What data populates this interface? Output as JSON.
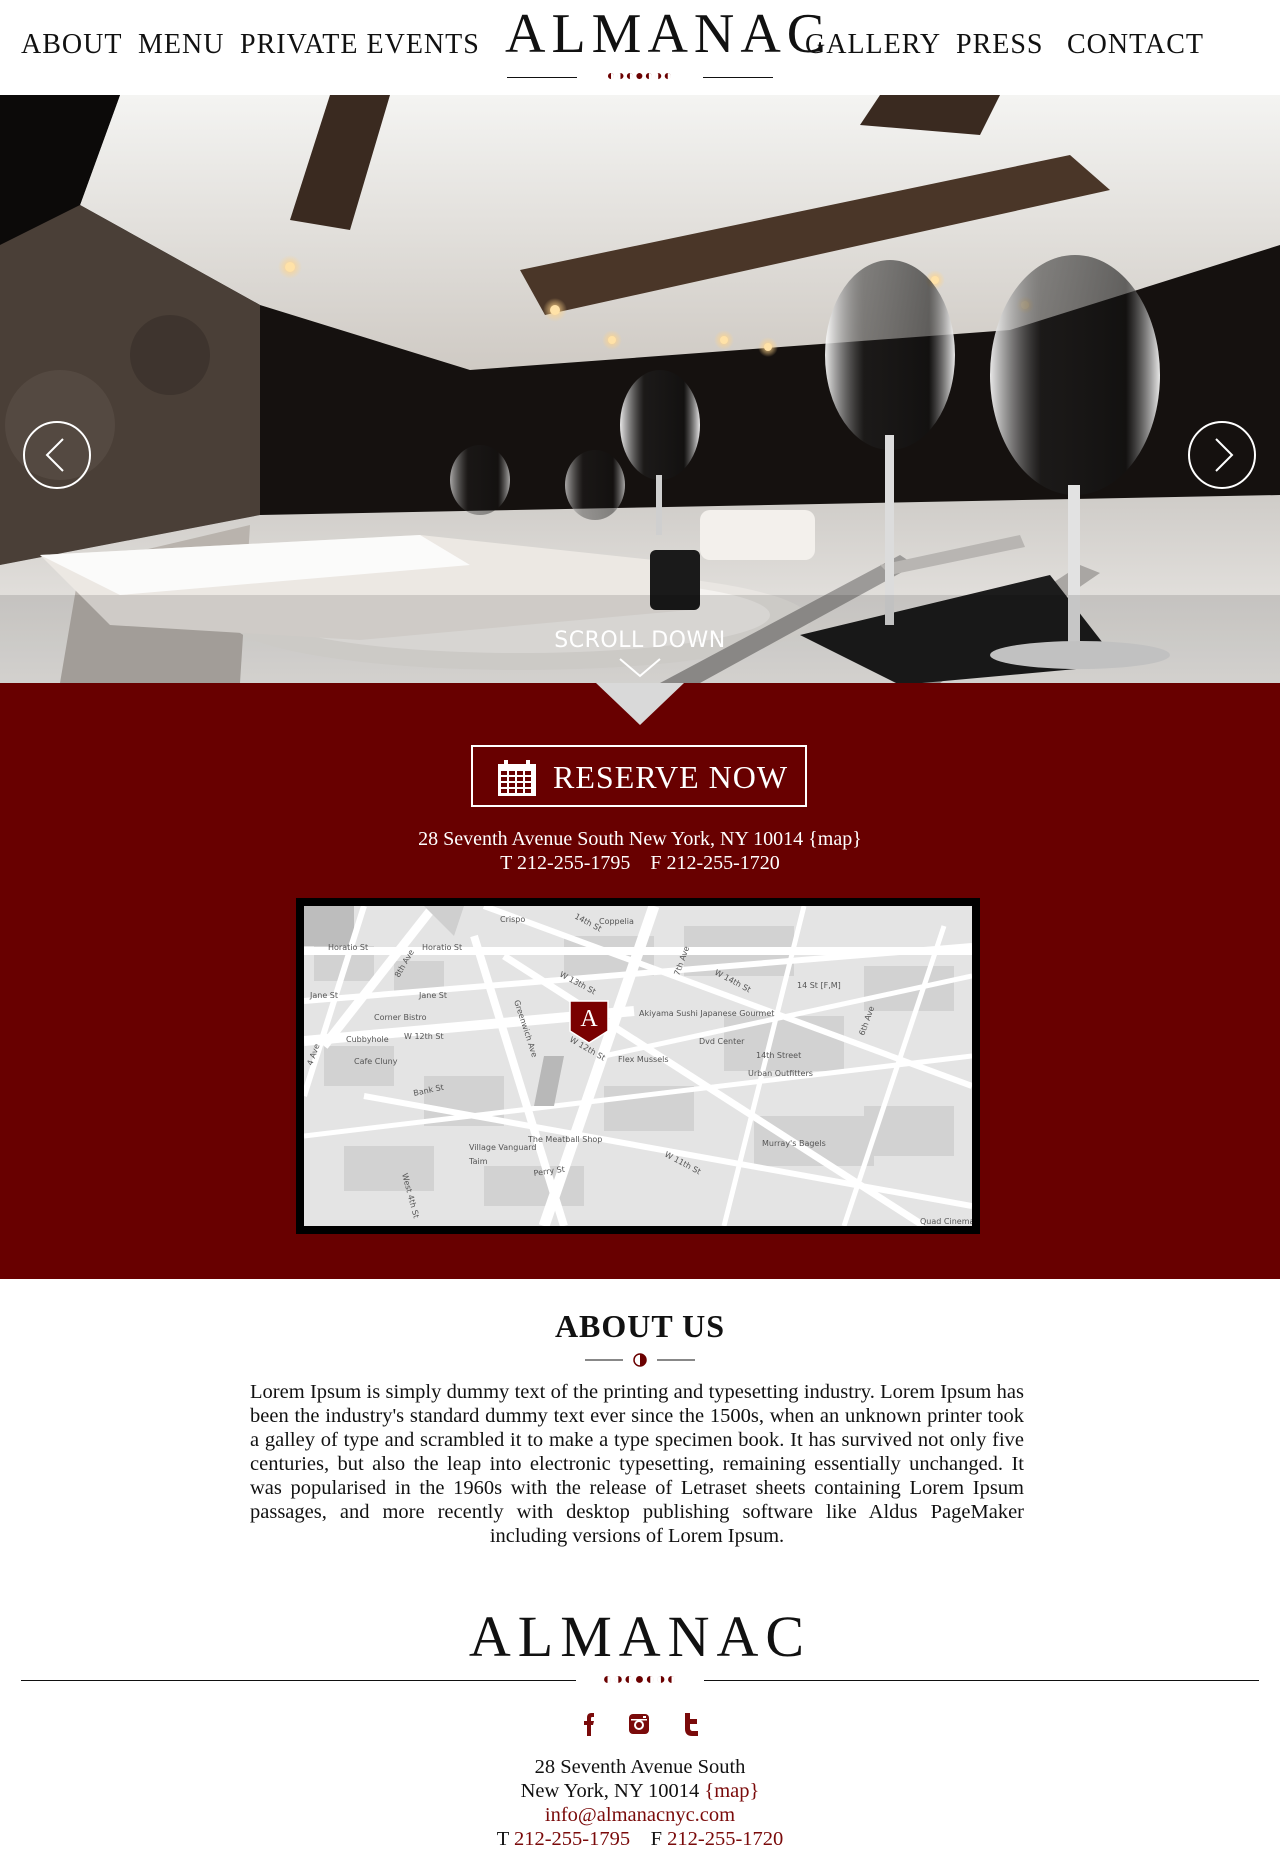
{
  "header": {
    "nav_left": [
      "ABOUT",
      "MENU",
      "PRIVATE EVENTS"
    ],
    "nav_right": [
      "GALLERY",
      "PRESS",
      "CONTACT"
    ],
    "logo": "ALMANAC",
    "logo_moons": "◐◑◐●◐◑◐"
  },
  "hero": {
    "scroll_label": "SCROLL DOWN",
    "prev_icon": "chevron-left-icon",
    "next_icon": "chevron-right-icon",
    "scroll_icon": "chevron-down-icon"
  },
  "reservation": {
    "button_label": "RESERVE NOW",
    "icon": "calendar-icon",
    "address_line": "28 Seventh Avenue South New York, NY 10014",
    "map_link": "{map}",
    "phone_prefix": "T",
    "phone": "212-255-1795",
    "fax_prefix": "F",
    "fax": "212-255-1720"
  },
  "map": {
    "marker_letter": "A",
    "streets": [
      "Horatio St",
      "Horatio St",
      "8th Ave",
      "Jane St",
      "Jane St",
      "W 13th St",
      "Greenwich Ave",
      "W 12th St",
      "W 12th St",
      "Bank St",
      "W 14th St",
      "14th St",
      "7th Ave",
      "6th Ave",
      "W 11th St",
      "Perry St",
      "West 4th St",
      "4 Ave",
      "14th Street",
      "14 St [F,M]"
    ],
    "places": [
      "Crispo",
      "Coppelia",
      "Corner Bistro",
      "Cubbyhole",
      "Cafe Cluny",
      "Akiyama Sushi Japanese Gourmet",
      "Dvd Center",
      "Flex Mussels",
      "Urban Outfitters",
      "Murray's Bagels",
      "The Meatball Shop",
      "Village Vanguard",
      "Taim",
      "Quad Cinema"
    ]
  },
  "about": {
    "title": "ABOUT US",
    "ornament": "◑",
    "body": "Lorem Ipsum is simply dummy text of the printing and typesetting industry. Lorem Ipsum has been the industry's standard dummy text ever since the 1500s, when an unknown printer took a galley of type and scrambled it to make a type specimen book. It has survived not only five centuries, but also the leap into electronic typesetting, remaining essentially unchanged. It was popularised in the 1960s with the release of Letraset sheets containing Lorem Ipsum passages, and more recently with desktop publishing software like Aldus PageMaker including versions of Lorem Ipsum."
  },
  "footer": {
    "logo": "ALMANAC",
    "logo_moons": "◐◑◐●◐◑◐",
    "social_icons": [
      "facebook-icon",
      "instagram-icon",
      "twitter-icon"
    ],
    "address_line1": "28 Seventh Avenue South",
    "address_line2": "New York, NY 10014",
    "map_link": "{map}",
    "email": "info@almanacnyc.com",
    "phone_prefix": "T",
    "phone": "212-255-1795",
    "fax_prefix": "F",
    "fax": "212-255-1720"
  },
  "colors": {
    "brand_red": "#680000",
    "link_red": "#7a0a0a",
    "text": "#111111",
    "background": "#ffffff"
  }
}
